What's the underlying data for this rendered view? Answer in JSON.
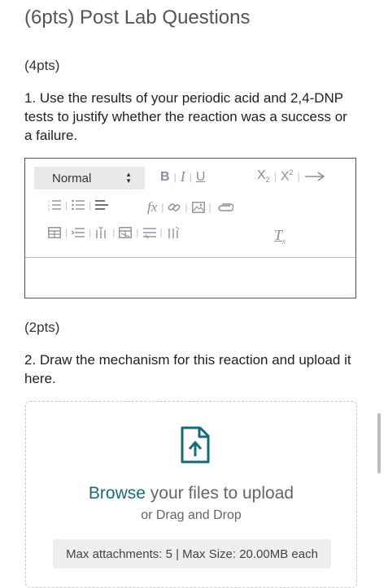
{
  "section_title": "(6pts) Post Lab Questions",
  "q1": {
    "points": "(4pts)",
    "text": "1. Use the results of your periodic acid and 2,4-DNP tests to justify whether the reaction was a success or a failure."
  },
  "editor": {
    "format_value": "Normal",
    "buttons": {
      "bold": "B",
      "italic": "I",
      "underline": "U",
      "subscript_base": "X",
      "subscript_mark": "2",
      "superscript_base": "X",
      "superscript_mark": "2",
      "formula": "fx",
      "clear_format": "T",
      "clear_format_mark": "x"
    },
    "icons": [
      "arrow-right-icon",
      "ordered-list-icon",
      "unordered-list-icon",
      "align-icon",
      "link-icon",
      "image-icon",
      "attachment-icon",
      "table-icon",
      "insert-row-icon",
      "insert-column-icon",
      "delete-table-icon",
      "delete-row-icon",
      "delete-column-icon"
    ]
  },
  "q2": {
    "points": "(2pts)",
    "text": "2. Draw the mechanism for this reaction and upload it here."
  },
  "upload": {
    "browse_link": "Browse",
    "browse_rest": " your files to upload",
    "drag_text": "or Drag and Drop",
    "limits": "Max attachments: 5 | Max Size: 20.00MB each"
  },
  "colors": {
    "accent": "#1a6a78",
    "toolbar_icon": "#8a8fa0",
    "select_bg": "#eaeaea"
  }
}
